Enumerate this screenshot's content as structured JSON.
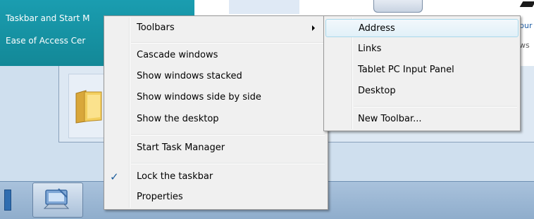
{
  "background": {
    "panel_lines": [
      "Taskbar and Start M",
      "Ease of Access Cer"
    ],
    "right_fragments": [
      "bur",
      "ws"
    ]
  },
  "context_menu": {
    "toolbars_label": "Toolbars",
    "cascade_label": "Cascade windows",
    "stacked_label": "Show windows stacked",
    "side_by_side_label": "Show windows side by side",
    "show_desktop_label": "Show the desktop",
    "task_manager_label": "Start Task Manager",
    "lock_taskbar_label": "Lock the taskbar",
    "lock_taskbar_checked": true,
    "check_glyph": "✓",
    "properties_label": "Properties"
  },
  "toolbars_submenu": {
    "address_label": "Address",
    "links_label": "Links",
    "tablet_pc_label": "Tablet PC Input Panel",
    "desktop_label": "Desktop",
    "new_toolbar_label": "New Toolbar..."
  },
  "colors": {
    "panel_teal": "#1a9db0",
    "highlight_border": "#a8d8eb",
    "menu_bg": "#f0f0f0",
    "taskbar": "#a9c2dc"
  },
  "icons": [
    "folder-icon",
    "taskbar-app-icon",
    "submenu-arrow-icon",
    "checkmark-icon"
  ]
}
